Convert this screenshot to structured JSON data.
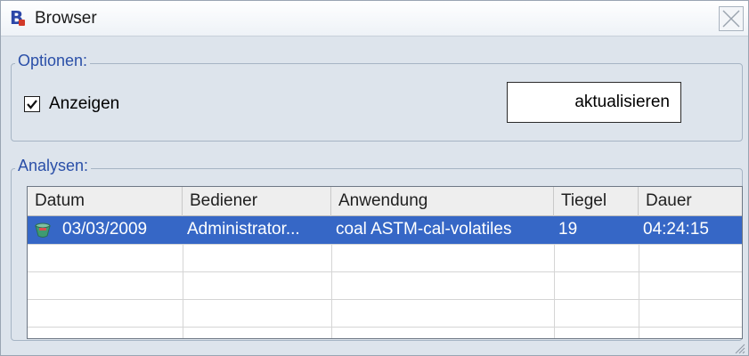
{
  "window": {
    "title": "Browser",
    "app_icon_letter": "B"
  },
  "options": {
    "legend": "Optionen:",
    "show_checkbox": {
      "label": "Anzeigen",
      "checked": true
    },
    "refresh_button": "aktualisieren"
  },
  "analyses": {
    "legend": "Analysen:",
    "columns": [
      "Datum",
      "Bediener",
      "Anwendung",
      "Tiegel",
      "Dauer"
    ],
    "rows": [
      {
        "icon": "crucible-icon",
        "datum": "03/03/2009",
        "bediener": "Administrator...",
        "anwendung": "coal ASTM-cal-volatiles",
        "tiegel": "19",
        "dauer": "04:24:15",
        "selected": true
      }
    ]
  },
  "colors": {
    "selection": "#3667c6",
    "legend_text": "#2a4fa8",
    "window_bg": "#dde4ec"
  }
}
